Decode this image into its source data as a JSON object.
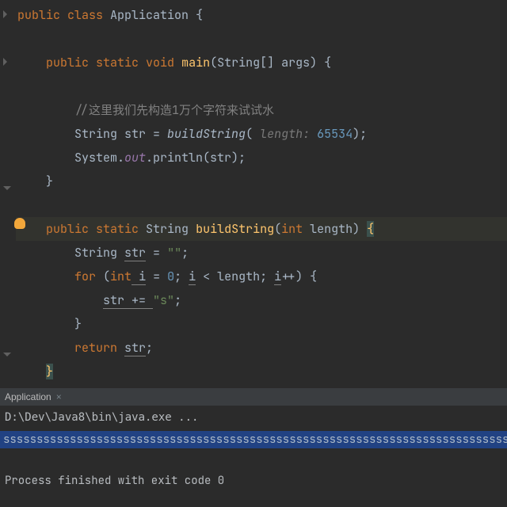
{
  "code": {
    "l1_kw1": "public ",
    "l1_kw2": "class ",
    "l1_name": "Application ",
    "l1_brace": "{",
    "l3_kw1": "public ",
    "l3_kw2": "static ",
    "l3_kw3": "void ",
    "l3_fn": "main",
    "l3_sig": "(String[] args) {",
    "l5_comment": "//这里我们先构造1万个字符来试试水",
    "l6_a": "String str = ",
    "l6_fn": "buildString",
    "l6_p1": "( ",
    "l6_hint": "length: ",
    "l6_num": "65534",
    "l6_end": ");",
    "l7_a": "System.",
    "l7_out": "out",
    "l7_b": ".println(str);",
    "l8_close": "}",
    "l10_kw1": "public ",
    "l10_kw2": "static ",
    "l10_type": "String ",
    "l10_fn": "buildString",
    "l10_p1": "(",
    "l10_kw3": "int ",
    "l10_param": "length) ",
    "l10_brace": "{",
    "l11_a": "String ",
    "l11_var": "str",
    "l11_b": " = ",
    "l11_str": "\"\"",
    "l11_c": ";",
    "l12_kw": "for ",
    "l12_a": "(",
    "l12_int": "int",
    "l12_i1": " i",
    "l12_eq": " = ",
    "l12_zero": "0",
    "l12_sc1": "; ",
    "l12_i2": "i",
    "l12_cmp": " < length; ",
    "l12_i3": "i",
    "l12_inc": "++) {",
    "l13_var": "str",
    "l13_op": " += ",
    "l13_str": "\"s\"",
    "l13_sc": ";",
    "l14_close": "}",
    "l15_kw": "return ",
    "l15_var": "str",
    "l15_sc": ";",
    "l16_close": "}"
  },
  "console": {
    "tab_name": "Application",
    "exec_line": "D:\\Dev\\Java8\\bin\\java.exe ...",
    "output": "sssssssssssssssssssssssssssssssssssssssssssssssssssssssssssssssssssssssssssssss",
    "process": "Process finished with exit code 0"
  }
}
